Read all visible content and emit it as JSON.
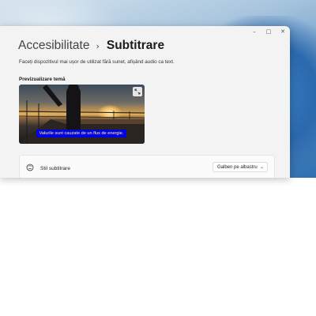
{
  "window": {
    "controls": {
      "minimize": "–",
      "maximize": "□",
      "close": "✕"
    }
  },
  "breadcrumb": {
    "parent": "Accesibilitate",
    "separator": "›",
    "current": "Subtitrare"
  },
  "description": "Faceți dispozitivul mai ușor de utilizat fără sunet, afișând audio ca text.",
  "preview": {
    "label": "Previzualizare temă",
    "caption": "Valurile sunt cauzate de un flux de energie.",
    "caption_bg_color": "#0000e6",
    "caption_text_color": "#ffff66",
    "expand_icon": "expand-icon"
  },
  "caption_style": {
    "icon": "caption-style-icon",
    "label": "Stil subtitrare",
    "selected_value": "Galben pe albastru",
    "chevron": "⌄"
  }
}
